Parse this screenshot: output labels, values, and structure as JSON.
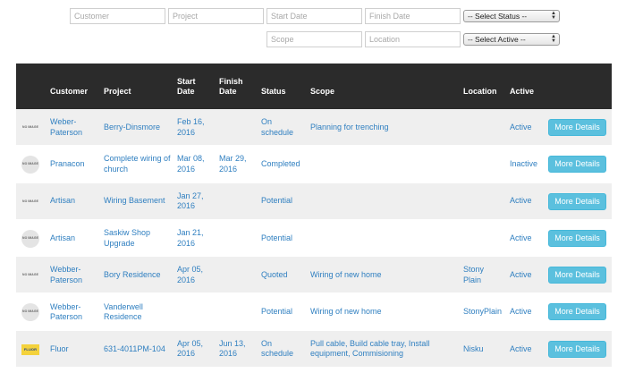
{
  "filters": {
    "customer_placeholder": "Customer",
    "project_placeholder": "Project",
    "start_date_placeholder": "Start Date",
    "finish_date_placeholder": "Finish Date",
    "status_select": "-- Select Status --",
    "scope_placeholder": "Scope",
    "location_placeholder": "Location",
    "active_select": "-- Select Active --"
  },
  "columns": {
    "customer": "Customer",
    "project": "Project",
    "start_date": "Start Date",
    "finish_date": "Finish Date",
    "status": "Status",
    "scope": "Scope",
    "location": "Location",
    "active": "Active"
  },
  "thumb_label": "NO IMAGE",
  "logo_label": "FLUOR",
  "button_label": "More Details",
  "rows": [
    {
      "customer": "Weber-Paterson",
      "project": "Berry-Dinsmore",
      "start": "Feb 16, 2016",
      "finish": "",
      "status": "On schedule",
      "scope": "Planning for trenching",
      "location": "",
      "active": "Active",
      "thumb": "rect"
    },
    {
      "customer": "Pranacon",
      "project": "Complete wiring of church",
      "start": "Mar 08, 2016",
      "finish": "Mar 29, 2016",
      "status": "Completed",
      "scope": "",
      "location": "",
      "active": "Inactive",
      "thumb": "circle"
    },
    {
      "customer": "Artisan",
      "project": "Wiring Basement",
      "start": "Jan 27, 2016",
      "finish": "",
      "status": "Potential",
      "scope": "",
      "location": "",
      "active": "Active",
      "thumb": "rect"
    },
    {
      "customer": "Artisan",
      "project": "Saskiw Shop Upgrade",
      "start": "Jan 21, 2016",
      "finish": "",
      "status": "Potential",
      "scope": "",
      "location": "",
      "active": "Active",
      "thumb": "circle"
    },
    {
      "customer": "Webber-Paterson",
      "project": "Bory Residence",
      "start": "Apr 05, 2016",
      "finish": "",
      "status": "Quoted",
      "scope": "Wiring of new home",
      "location": "Stony Plain",
      "active": "Active",
      "thumb": "rect"
    },
    {
      "customer": "Webber-Paterson",
      "project": "Vanderwell Residence",
      "start": "",
      "finish": "",
      "status": "Potential",
      "scope": "Wiring of new home",
      "location": "StonyPlain",
      "active": "Active",
      "thumb": "circle"
    },
    {
      "customer": "Fluor",
      "project": "631-4011PM-104",
      "start": "Apr 05, 2016",
      "finish": "Jun 13, 2016",
      "status": "On schedule",
      "scope": "Pull cable, Build cable tray, Install equipment, Commisioning",
      "location": "Nisku",
      "active": "Active",
      "thumb": "logo"
    }
  ]
}
